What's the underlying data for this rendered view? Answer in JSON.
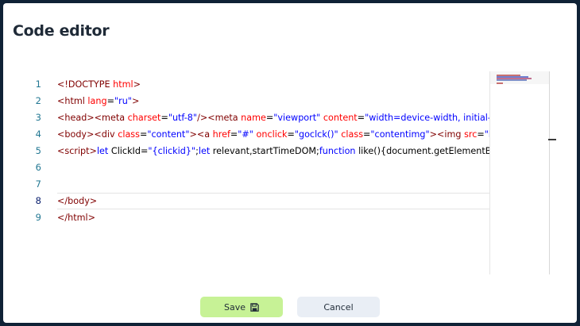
{
  "header": {
    "title": "Code editor"
  },
  "editor": {
    "lines": [
      {
        "num": "1",
        "code": "<!DOCTYPE html>"
      },
      {
        "num": "2",
        "code": "<html lang=\"ru\">"
      },
      {
        "num": "3",
        "code": "<head><meta charset=\"utf-8\"/><meta name=\"viewport\" content=\"width=device-width, initial-s"
      },
      {
        "num": "4",
        "code": "<body><div class=\"content\"><a href=\"#\" onclick=\"goclck()\" class=\"contentimg\"><img src=\"htt"
      },
      {
        "num": "5",
        "code": "<script>let ClickId=\"{clickid}\";let relevant,startTimeDOM;function like(){document.getElementBy"
      },
      {
        "num": "6",
        "code": ""
      },
      {
        "num": "7",
        "code": ""
      },
      {
        "num": "8",
        "code": "</body>"
      },
      {
        "num": "9",
        "code": "</html>"
      }
    ],
    "current_line": "8"
  },
  "footer": {
    "save_label": "Save",
    "cancel_label": "Cancel"
  },
  "icons": {
    "save": "save-icon"
  },
  "colors": {
    "save_bg": "#c7f296",
    "cancel_bg": "#e9eef5",
    "backdrop": "#0f2236"
  }
}
